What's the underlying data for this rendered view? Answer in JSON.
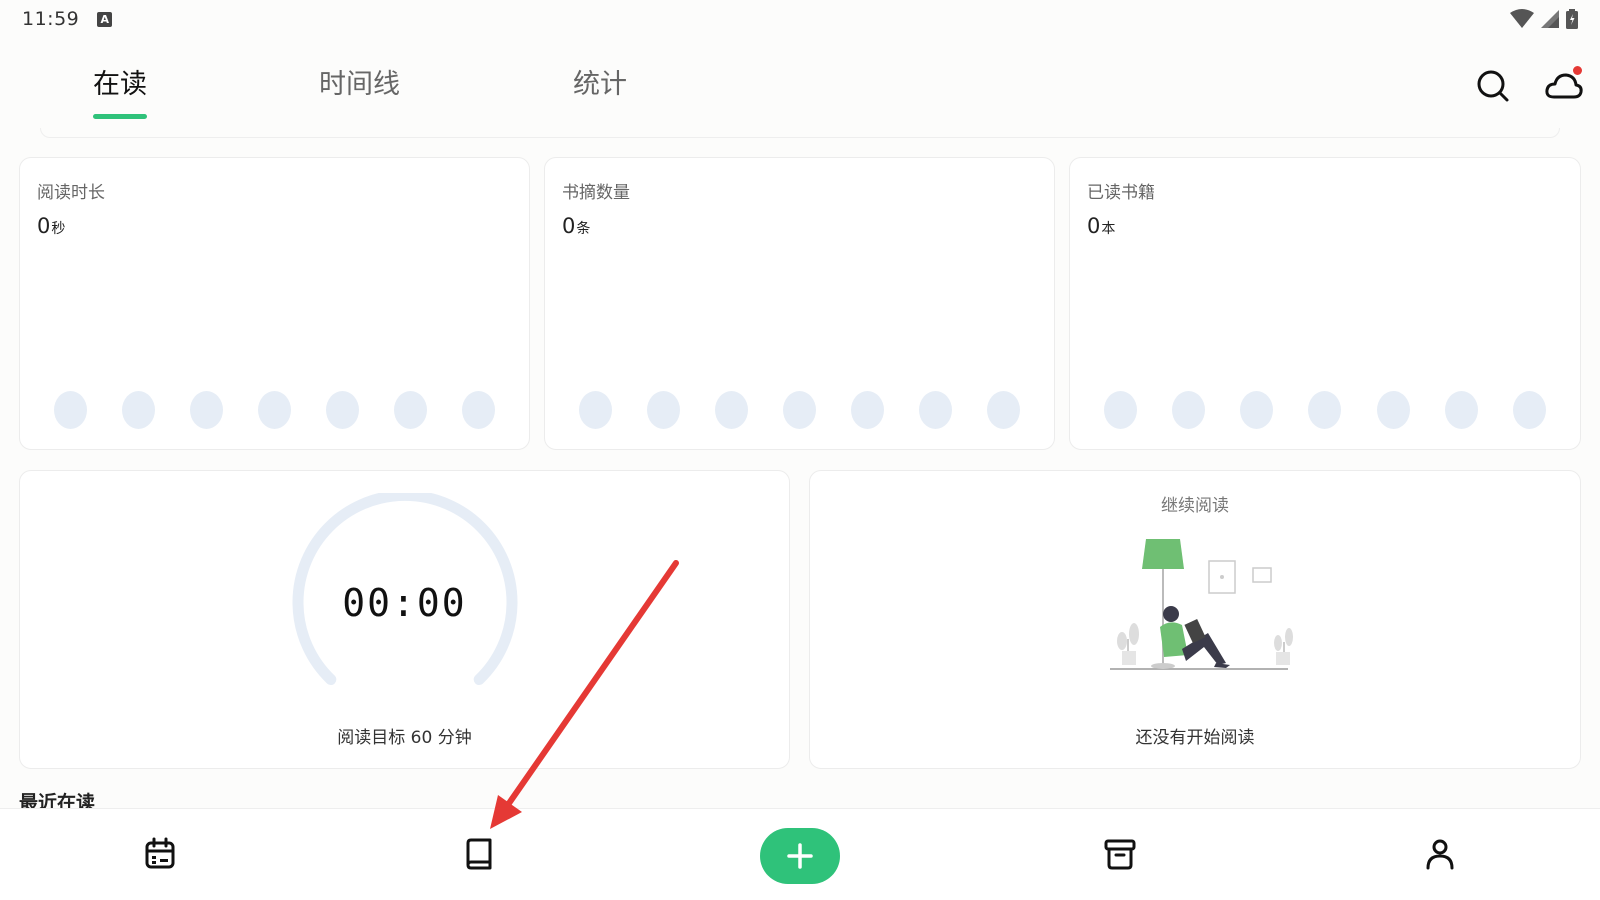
{
  "status_bar": {
    "time": "11:59",
    "indicator": "A"
  },
  "tabs": [
    {
      "label": "在读",
      "active": true
    },
    {
      "label": "时间线",
      "active": false
    },
    {
      "label": "统计",
      "active": false
    }
  ],
  "header_icons": [
    "search-icon",
    "cloud-icon"
  ],
  "stats": [
    {
      "title": "阅读时长",
      "value": "0",
      "unit": "秒"
    },
    {
      "title": "书摘数量",
      "value": "0",
      "unit": "条"
    },
    {
      "title": "已读书籍",
      "value": "0",
      "unit": "本"
    }
  ],
  "timer": {
    "display": "00:00",
    "goal_text": "阅读目标 60 分钟"
  },
  "continue_reading": {
    "title": "继续阅读",
    "empty_text": "还没有开始阅读"
  },
  "recent": {
    "title": "最近在读"
  },
  "bottom_nav": {
    "items": [
      "calendar-icon",
      "book-icon",
      "add-icon",
      "archive-icon",
      "profile-icon"
    ],
    "fab_symbol": "+"
  },
  "colors": {
    "accent": "#2fc27a",
    "dot": "#e6edf6",
    "annotation_arrow": "#e53935"
  }
}
